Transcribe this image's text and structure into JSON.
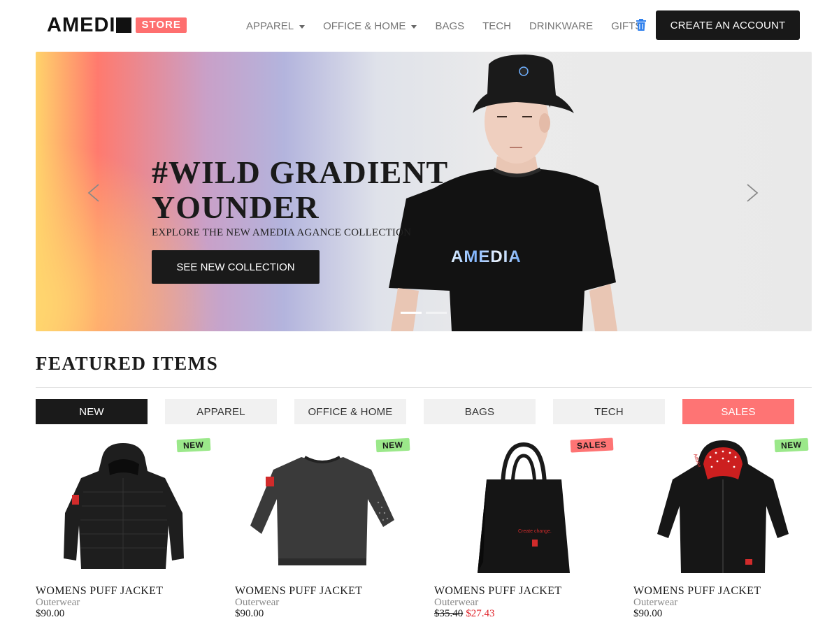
{
  "header": {
    "logo_word": "AMEDI",
    "logo_store": "STORE",
    "nav": [
      {
        "label": "APPAREL",
        "dropdown": true
      },
      {
        "label": "OFFICE & HOME",
        "dropdown": true
      },
      {
        "label": "BAGS",
        "dropdown": false
      },
      {
        "label": "TECH",
        "dropdown": false
      },
      {
        "label": "DRINKWARE",
        "dropdown": false
      },
      {
        "label": "GIFTS",
        "dropdown": false
      }
    ],
    "cart_icon": "trash-cart-icon",
    "cta_label": "CREATE AN ACCOUNT"
  },
  "hero": {
    "title_line1": "#WILD GRADIENT",
    "title_line2": "YOUNDER",
    "subtitle": "EXPLORE THE NEW AMEDIA AGANCE COLLECTION",
    "button_label": "SEE NEW COLLECTION",
    "shirt_text": "AMEDIA",
    "prev_icon": "chevron-left-icon",
    "next_icon": "chevron-right-icon",
    "slide_count": 2,
    "active_slide": 1
  },
  "featured": {
    "title": "FEATURED ITEMS",
    "tabs": [
      {
        "label": "NEW",
        "state": "active"
      },
      {
        "label": "APPAREL",
        "state": "default"
      },
      {
        "label": "OFFICE & HOME",
        "state": "default"
      },
      {
        "label": "BAGS",
        "state": "default"
      },
      {
        "label": "TECH",
        "state": "default"
      },
      {
        "label": "SALES",
        "state": "sales"
      }
    ],
    "products": [
      {
        "name": "WOMENS PUFF JACKET",
        "category": "Outerwear",
        "price": "$90.00",
        "old_price": "",
        "sale_price": "",
        "badge": "NEW",
        "image": "puffer-jacket"
      },
      {
        "name": "WOMENS PUFF JACKET",
        "category": "Outerwear",
        "price": "$90.00",
        "old_price": "",
        "sale_price": "",
        "badge": "NEW",
        "image": "sweatshirt"
      },
      {
        "name": "WOMENS PUFF JACKET",
        "category": "Outerwear",
        "price": "",
        "old_price": "$35.40",
        "sale_price": "$27.43",
        "badge": "SALES",
        "image": "tote-bag"
      },
      {
        "name": "WOMENS PUFF JACKET",
        "category": "Outerwear",
        "price": "$90.00",
        "old_price": "",
        "sale_price": "",
        "badge": "NEW",
        "image": "hoodie"
      }
    ]
  },
  "colors": {
    "brand_coral": "#fe7474",
    "dark": "#1a1a1a",
    "badge_new": "#9be88a",
    "sale_red": "#e0242b",
    "cart_blue": "#2f80ed"
  }
}
